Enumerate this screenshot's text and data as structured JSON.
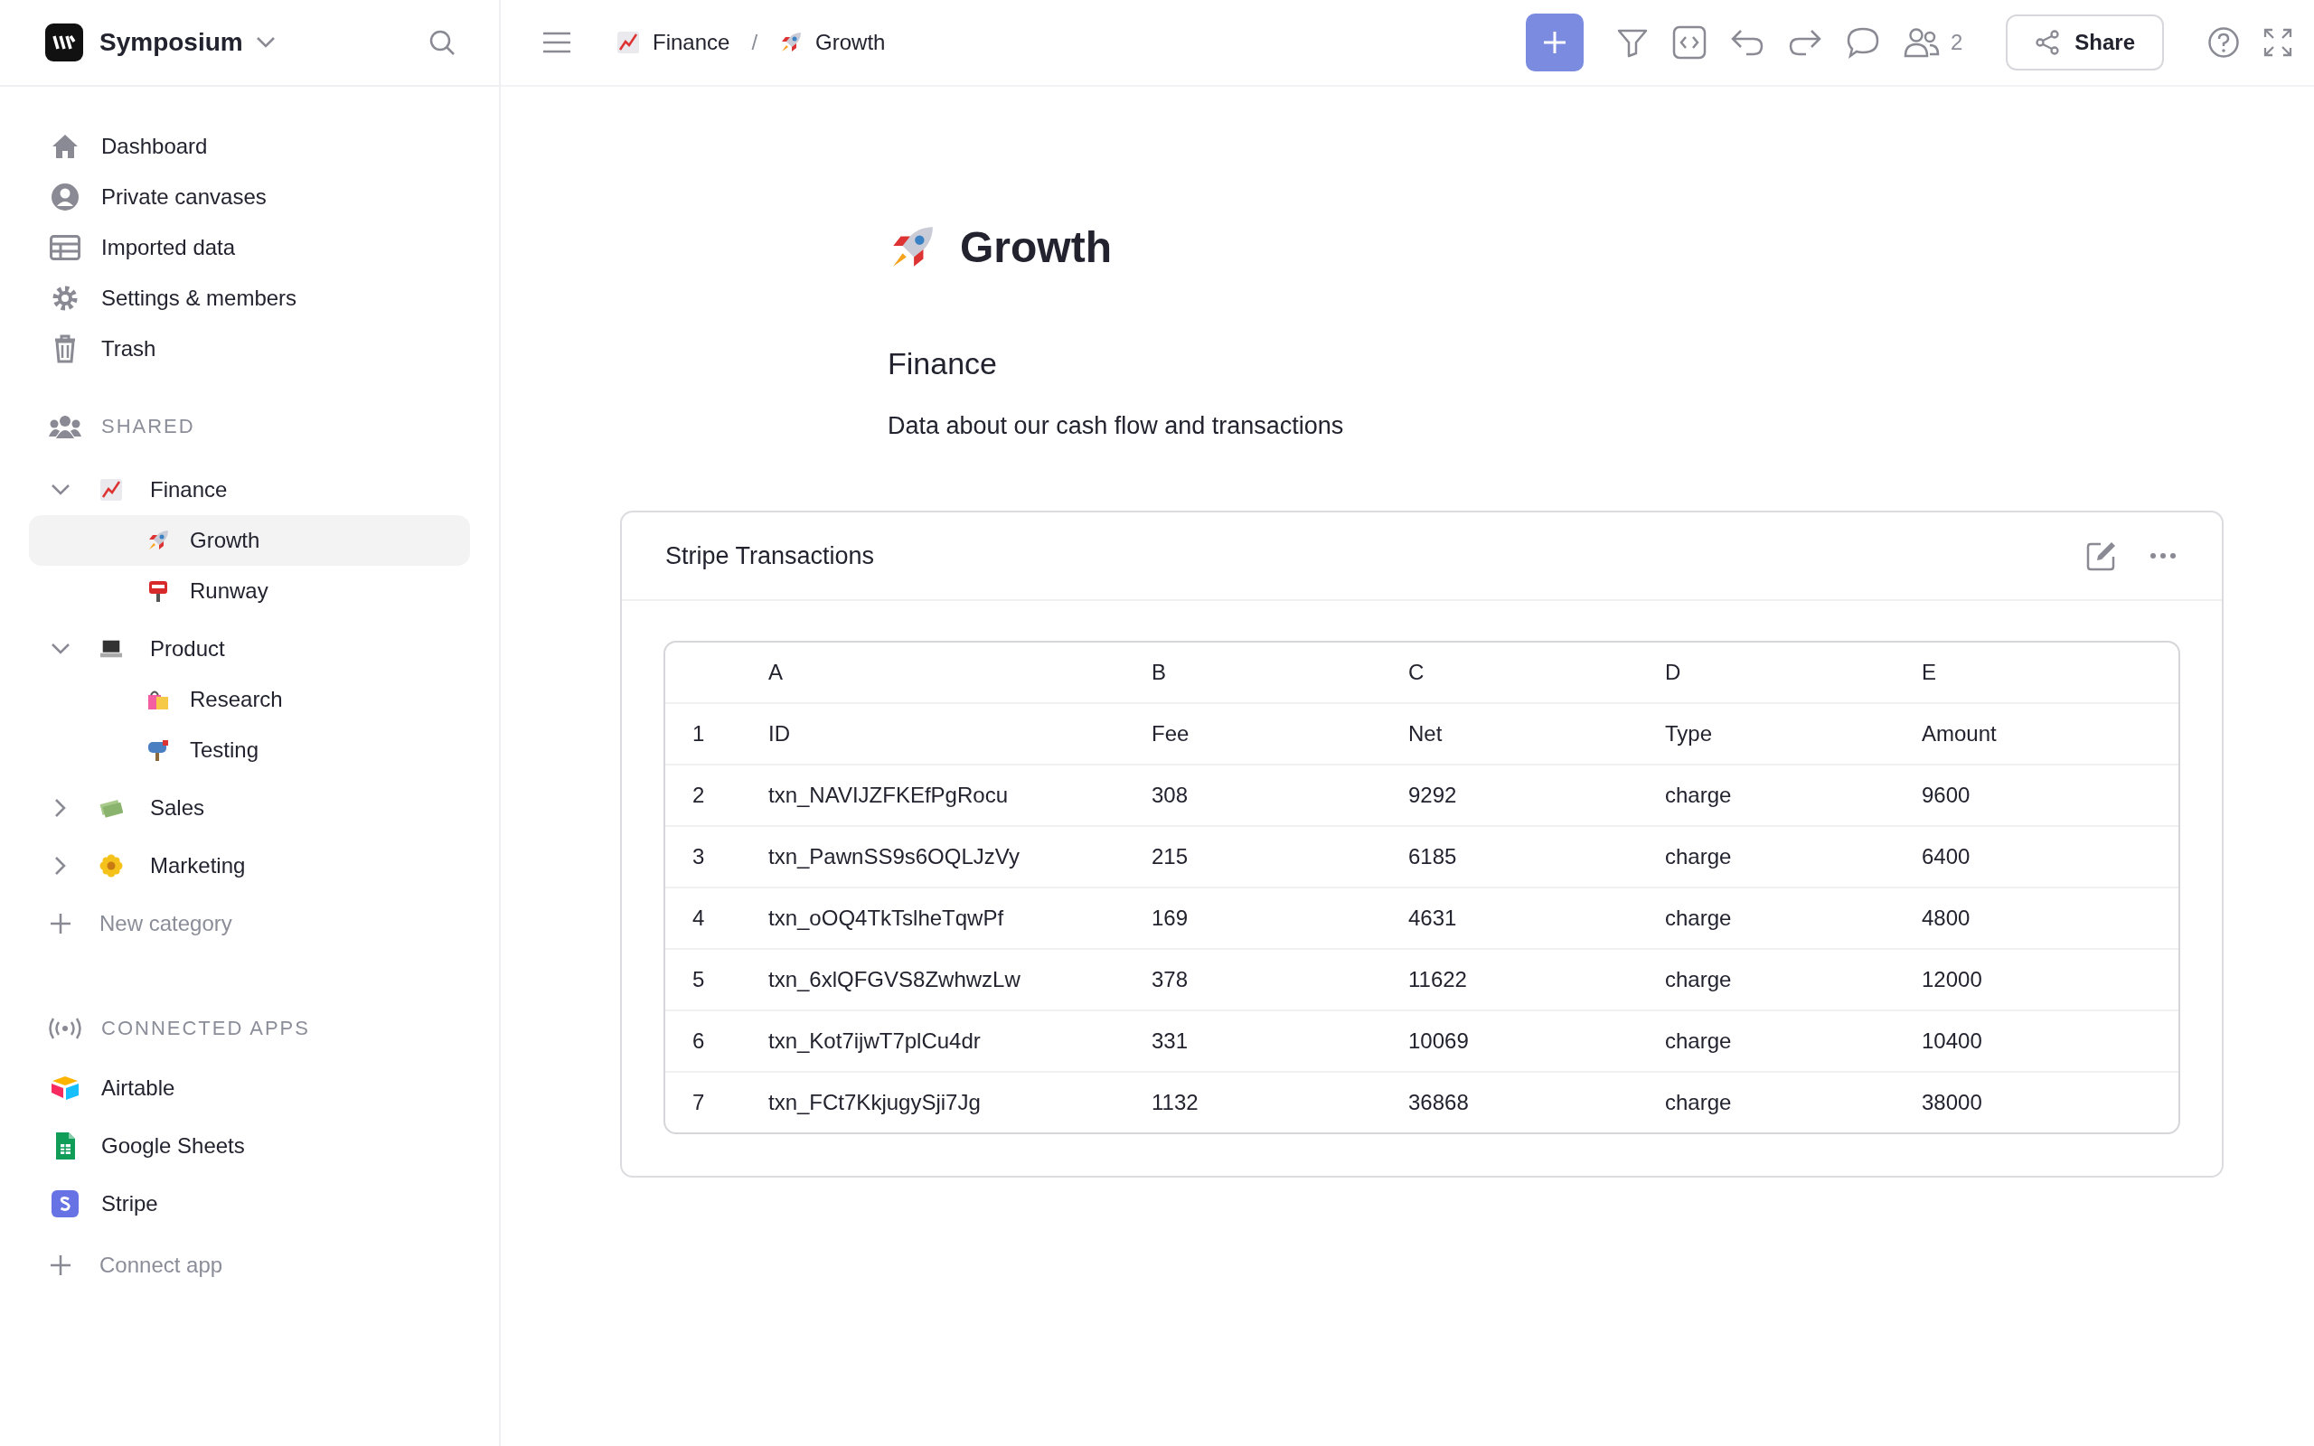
{
  "workspace": {
    "name": "Symposium"
  },
  "nav": [
    {
      "label": "Dashboard",
      "selected": false
    },
    {
      "label": "Private canvases",
      "selected": false
    },
    {
      "label": "Imported data",
      "selected": false
    },
    {
      "label": "Settings & members",
      "selected": false
    },
    {
      "label": "Trash",
      "selected": false
    }
  ],
  "shared": {
    "heading": "SHARED",
    "categories": [
      {
        "label": "Finance",
        "expanded": true,
        "children": [
          {
            "label": "Growth",
            "selected": true
          },
          {
            "label": "Runway",
            "selected": false
          }
        ]
      },
      {
        "label": "Product",
        "expanded": true,
        "children": [
          {
            "label": "Research",
            "selected": false
          },
          {
            "label": "Testing",
            "selected": false
          }
        ]
      },
      {
        "label": "Sales",
        "expanded": false
      },
      {
        "label": "Marketing",
        "expanded": false
      }
    ],
    "add_label": "New category"
  },
  "connected_apps": {
    "heading": "CONNECTED APPS",
    "apps": [
      {
        "label": "Airtable"
      },
      {
        "label": "Google Sheets"
      },
      {
        "label": "Stripe"
      }
    ],
    "add_label": "Connect app"
  },
  "breadcrumb": [
    {
      "label": "Finance"
    },
    {
      "label": "Growth"
    }
  ],
  "breadcrumb_separator": "/",
  "collaborators_count": "2",
  "share_button": "Share",
  "page": {
    "title": "Growth",
    "section_title": "Finance",
    "description": "Data about our cash flow and transactions"
  },
  "card": {
    "title": "Stripe Transactions",
    "table": {
      "columns": [
        "A",
        "B",
        "C",
        "D",
        "E"
      ],
      "rows": [
        {
          "num": "1",
          "cells": [
            "ID",
            "Fee",
            "Net",
            "Type",
            "Amount"
          ]
        },
        {
          "num": "2",
          "cells": [
            "txn_NAVIJZFKEfPgRocu",
            "308",
            "9292",
            "charge",
            "9600"
          ]
        },
        {
          "num": "3",
          "cells": [
            "txn_PawnSS9s6OQLJzVy",
            "215",
            "6185",
            "charge",
            "6400"
          ]
        },
        {
          "num": "4",
          "cells": [
            "txn_oOQ4TkTslheTqwPf",
            "169",
            "4631",
            "charge",
            "4800"
          ]
        },
        {
          "num": "5",
          "cells": [
            "txn_6xlQFGVS8ZwhwzLw",
            "378",
            "11622",
            "charge",
            "12000"
          ]
        },
        {
          "num": "6",
          "cells": [
            "txn_Kot7ijwT7plCu4dr",
            "331",
            "10069",
            "charge",
            "10400"
          ]
        },
        {
          "num": "7",
          "cells": [
            "txn_FCt7KkjugySji7Jg",
            "1132",
            "36868",
            "charge",
            "38000"
          ]
        }
      ]
    }
  }
}
